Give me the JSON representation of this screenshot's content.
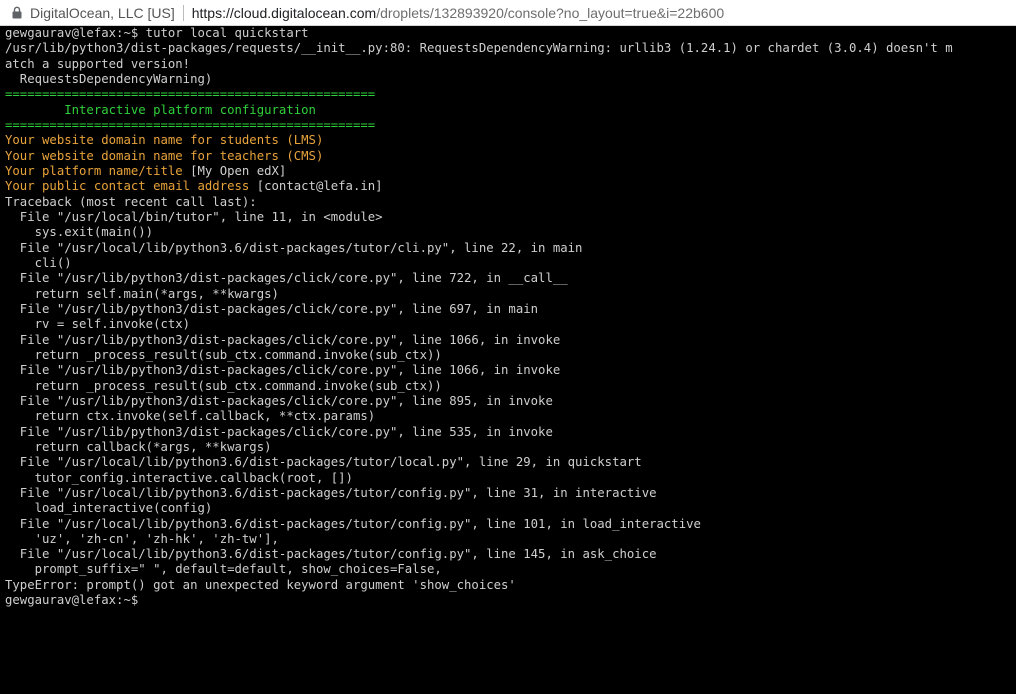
{
  "browser": {
    "owner": "DigitalOcean, LLC [US]",
    "url_host": "https://cloud.digitalocean.com",
    "url_rest": "/droplets/132893920/console?no_layout=true&i=22b600"
  },
  "colors": {
    "terminal_bg": "#000000",
    "text": "#cfcfcf",
    "green": "#2fd03a",
    "orange": "#e8a33a"
  },
  "terminal": {
    "lines": [
      {
        "text": "gewgaurav@lefax:~$ tutor local quickstart",
        "style": "normal"
      },
      {
        "text": "/usr/lib/python3/dist-packages/requests/__init__.py:80: RequestsDependencyWarning: urllib3 (1.24.1) or chardet (3.0.4) doesn't m",
        "style": "normal"
      },
      {
        "text": "atch a supported version!",
        "style": "normal"
      },
      {
        "text": "  RequestsDependencyWarning)",
        "style": "normal"
      },
      {
        "text": "==================================================",
        "style": "green"
      },
      {
        "text": "        Interactive platform configuration",
        "style": "green"
      },
      {
        "text": "==================================================",
        "style": "green"
      },
      {
        "text": "Your website domain name for students (LMS)",
        "style": "orange"
      },
      {
        "text": "Your website domain name for teachers (CMS)",
        "style": "orange"
      },
      {
        "prompt": "Your platform name/title",
        "default": " [My Open edX]",
        "style": "mixed"
      },
      {
        "prompt": "Your public contact email address",
        "default": " [contact@lefa.in]",
        "style": "mixed"
      },
      {
        "text": "Traceback (most recent call last):",
        "style": "normal"
      },
      {
        "text": "  File \"/usr/local/bin/tutor\", line 11, in <module>",
        "style": "normal"
      },
      {
        "text": "    sys.exit(main())",
        "style": "normal"
      },
      {
        "text": "  File \"/usr/local/lib/python3.6/dist-packages/tutor/cli.py\", line 22, in main",
        "style": "normal"
      },
      {
        "text": "    cli()",
        "style": "normal"
      },
      {
        "text": "  File \"/usr/lib/python3/dist-packages/click/core.py\", line 722, in __call__",
        "style": "normal"
      },
      {
        "text": "    return self.main(*args, **kwargs)",
        "style": "normal"
      },
      {
        "text": "  File \"/usr/lib/python3/dist-packages/click/core.py\", line 697, in main",
        "style": "normal"
      },
      {
        "text": "    rv = self.invoke(ctx)",
        "style": "normal"
      },
      {
        "text": "  File \"/usr/lib/python3/dist-packages/click/core.py\", line 1066, in invoke",
        "style": "normal"
      },
      {
        "text": "    return _process_result(sub_ctx.command.invoke(sub_ctx))",
        "style": "normal"
      },
      {
        "text": "  File \"/usr/lib/python3/dist-packages/click/core.py\", line 1066, in invoke",
        "style": "normal"
      },
      {
        "text": "    return _process_result(sub_ctx.command.invoke(sub_ctx))",
        "style": "normal"
      },
      {
        "text": "  File \"/usr/lib/python3/dist-packages/click/core.py\", line 895, in invoke",
        "style": "normal"
      },
      {
        "text": "    return ctx.invoke(self.callback, **ctx.params)",
        "style": "normal"
      },
      {
        "text": "  File \"/usr/lib/python3/dist-packages/click/core.py\", line 535, in invoke",
        "style": "normal"
      },
      {
        "text": "    return callback(*args, **kwargs)",
        "style": "normal"
      },
      {
        "text": "  File \"/usr/local/lib/python3.6/dist-packages/tutor/local.py\", line 29, in quickstart",
        "style": "normal"
      },
      {
        "text": "    tutor_config.interactive.callback(root, [])",
        "style": "normal"
      },
      {
        "text": "  File \"/usr/local/lib/python3.6/dist-packages/tutor/config.py\", line 31, in interactive",
        "style": "normal"
      },
      {
        "text": "    load_interactive(config)",
        "style": "normal"
      },
      {
        "text": "  File \"/usr/local/lib/python3.6/dist-packages/tutor/config.py\", line 101, in load_interactive",
        "style": "normal"
      },
      {
        "text": "    'uz', 'zh-cn', 'zh-hk', 'zh-tw'],",
        "style": "normal"
      },
      {
        "text": "  File \"/usr/local/lib/python3.6/dist-packages/tutor/config.py\", line 145, in ask_choice",
        "style": "normal"
      },
      {
        "text": "    prompt_suffix=\" \", default=default, show_choices=False,",
        "style": "normal"
      },
      {
        "text": "TypeError: prompt() got an unexpected keyword argument 'show_choices'",
        "style": "normal"
      },
      {
        "text": "gewgaurav@lefax:~$ ",
        "style": "normal"
      }
    ]
  }
}
